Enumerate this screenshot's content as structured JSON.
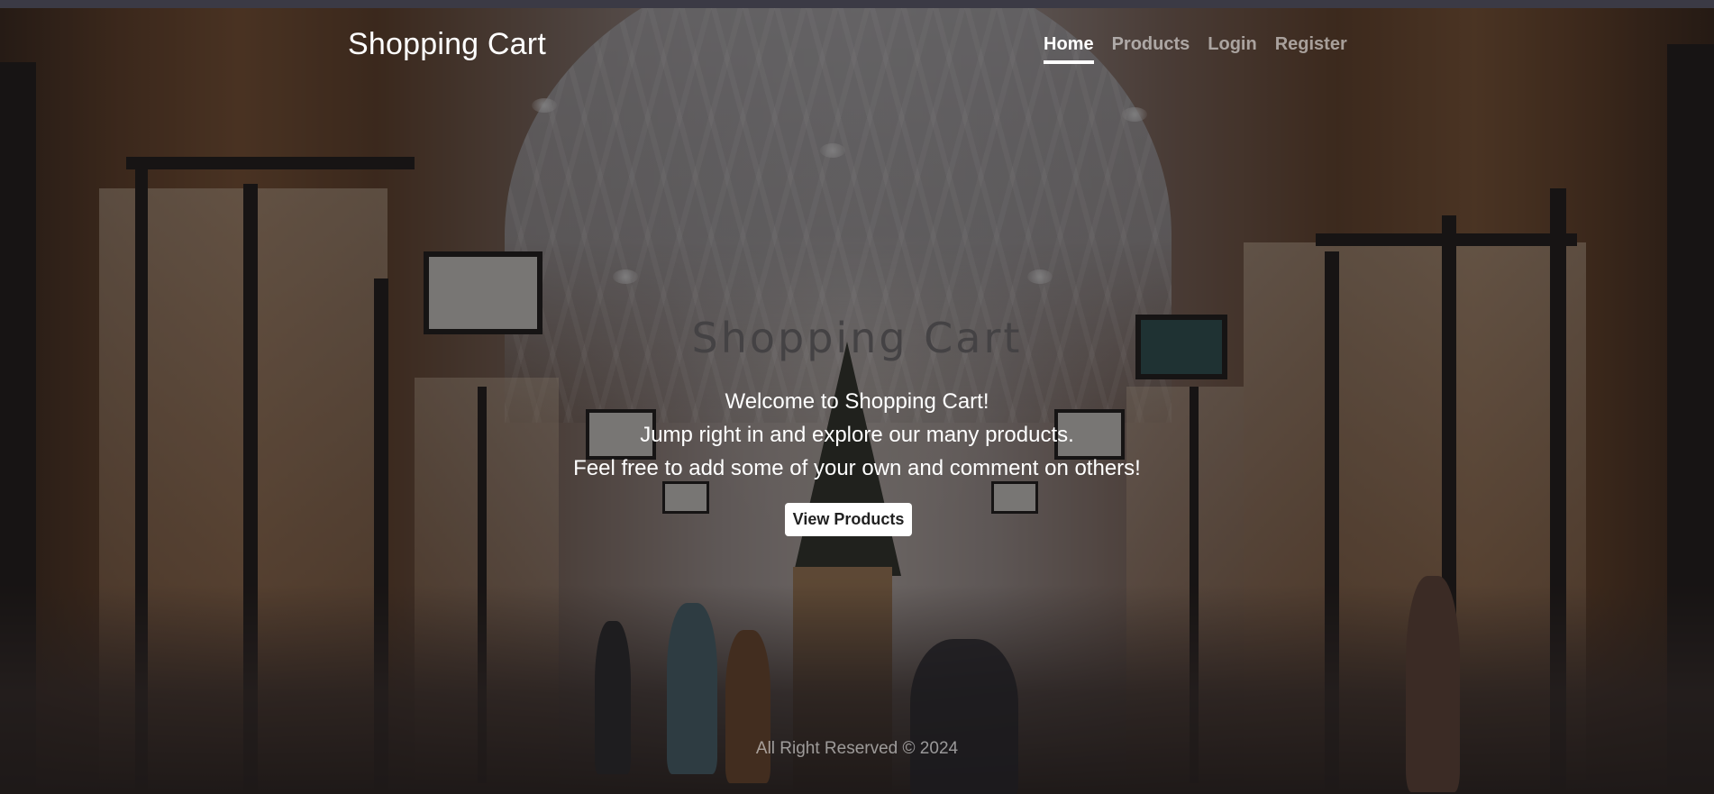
{
  "navbar": {
    "brand": "Shopping Cart",
    "links": [
      {
        "label": "Home",
        "active": true
      },
      {
        "label": "Products",
        "active": false
      },
      {
        "label": "Login",
        "active": false
      },
      {
        "label": "Register",
        "active": false
      }
    ]
  },
  "hero": {
    "title": "Shopping Cart",
    "lines": [
      "Welcome to Shopping Cart!",
      "Jump right in and explore our many products.",
      "Feel free to add some of your own and comment on others!"
    ],
    "button_label": "View Products"
  },
  "footer": {
    "text": "All Right Reserved © 2024"
  },
  "colors": {
    "overlay": "#141214",
    "text_primary": "#ffffff",
    "title_text": "#444244",
    "button_bg": "#ffffff"
  }
}
